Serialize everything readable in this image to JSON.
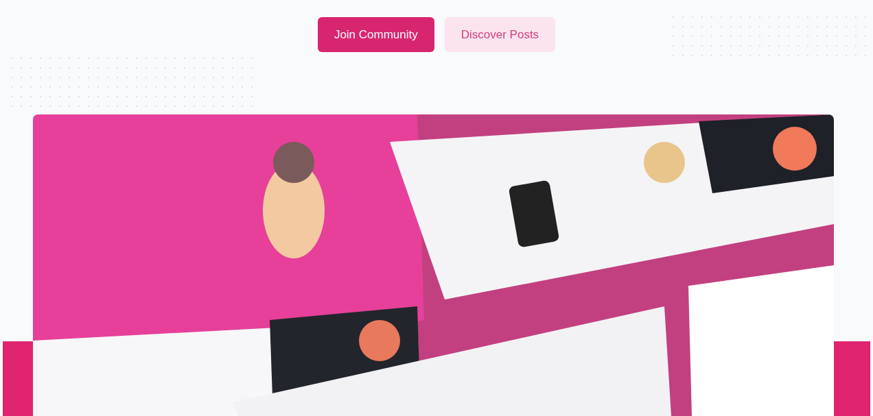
{
  "buttons": [
    {
      "label": "Join Community",
      "kind": "primary"
    },
    {
      "label": "Discover Posts",
      "kind": "secondary"
    }
  ]
}
